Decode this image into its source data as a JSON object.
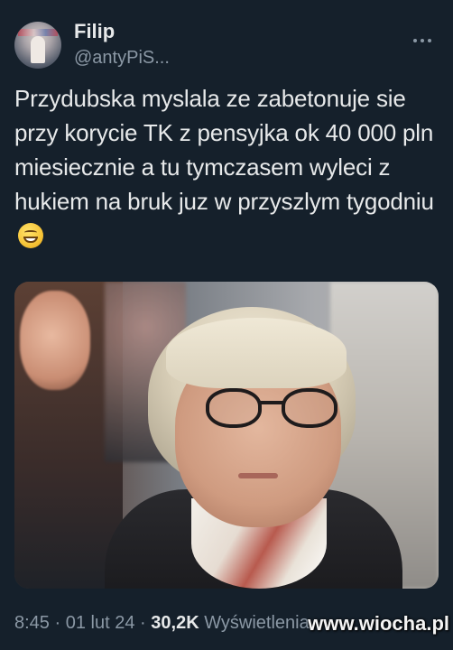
{
  "author": {
    "display_name": "Filip",
    "handle": "@antyPiS..."
  },
  "tweet": {
    "text": "Przydubska myslala ze zabetonuje sie przy korycie TK z pensyjka ok 40 000 pln miesiecznie a tu tymczasem wyleci z hukiem na bruk juz w przyszlym tygodniu",
    "emoji": "grinning-face-with-smiling-eyes",
    "photo_icon": "photo-portrait"
  },
  "meta": {
    "time": "8:45",
    "sep1": "·",
    "date": "01 lut 24",
    "sep2": "·",
    "views_count": "30,2K",
    "views_label": "Wyświetlenia"
  },
  "watermark": "www.wiocha.pl",
  "icons": {
    "more": "more-horizontal-icon"
  },
  "colors": {
    "background": "#15202b",
    "primary_text": "#e7e9ea",
    "secondary_text": "#8b98a5"
  }
}
